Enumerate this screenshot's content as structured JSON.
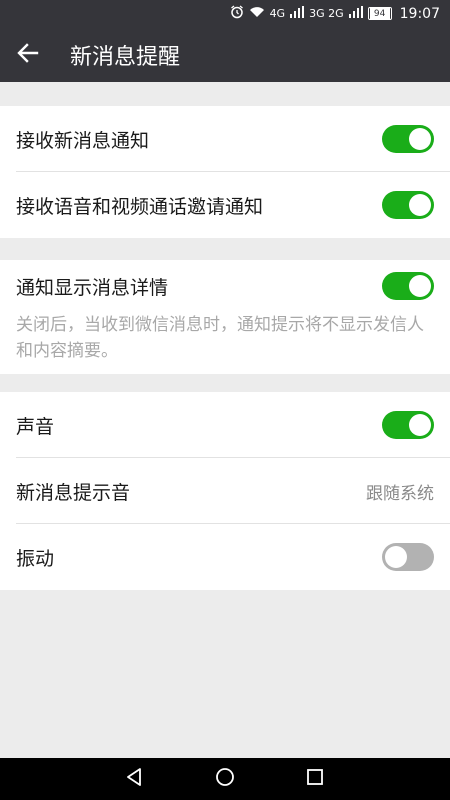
{
  "status_bar": {
    "signal_4g": "4G",
    "signal_3g": "3G 2G",
    "battery": "94",
    "time": "19:07"
  },
  "header": {
    "title": "新消息提醒"
  },
  "group1": {
    "rows": [
      {
        "label": "接收新消息通知",
        "toggle": "on"
      },
      {
        "label": "接收语音和视频通话邀请通知",
        "toggle": "on"
      }
    ]
  },
  "group2": {
    "row": {
      "label": "通知显示消息详情",
      "toggle": "on"
    },
    "description": "关闭后，当收到微信消息时，通知提示将不显示发信人和内容摘要。"
  },
  "group3": {
    "rows": [
      {
        "label": "声音",
        "toggle": "on"
      },
      {
        "label": "新消息提示音",
        "value": "跟随系统"
      },
      {
        "label": "振动",
        "toggle": "off"
      }
    ]
  },
  "colors": {
    "header_bg": "#35353a",
    "toggle_on": "#1aad19",
    "toggle_off": "#b2b2b2",
    "page_bg": "#ececec"
  },
  "icons": {
    "back": "arrow-left-icon",
    "nav_back": "triangle-back-icon",
    "nav_home": "circle-home-icon",
    "nav_recent": "square-recent-icon"
  }
}
